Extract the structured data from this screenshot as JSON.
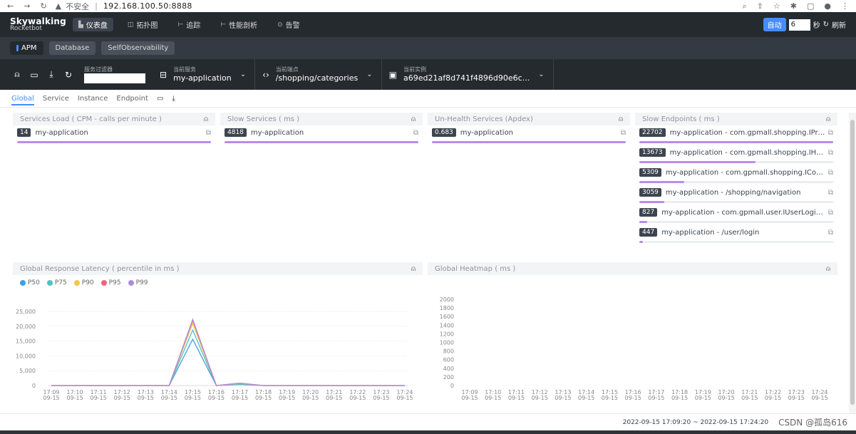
{
  "browser": {
    "security": "不安全",
    "url": "192.168.100.50:8888"
  },
  "topnav": {
    "logo_line1": "Skywalking",
    "logo_line2": "Rocketbot",
    "items": [
      {
        "icon": "dashboard-icon",
        "label": "仪表盘",
        "active": true
      },
      {
        "icon": "topology-icon",
        "label": "拓扑图",
        "active": false
      },
      {
        "icon": "trace-icon",
        "label": "追踪",
        "active": false
      },
      {
        "icon": "profile-icon",
        "label": "性能剖析",
        "active": false
      },
      {
        "icon": "alarm-icon",
        "label": "告警",
        "active": false
      }
    ],
    "auto_label": "自动",
    "interval_value": "6",
    "seconds_label": "秒",
    "refresh_label": "刷新"
  },
  "layers": [
    {
      "label": "APM",
      "active": true
    },
    {
      "label": "Database",
      "active": false
    },
    {
      "label": "SelfObservability",
      "active": false
    }
  ],
  "toolbar": {
    "filter_label": "服务过滤器",
    "service_label": "当前服务",
    "service_value": "my-application",
    "endpoint_label": "当前端点",
    "endpoint_value": "/shopping/categories",
    "instance_label": "当前实例",
    "instance_value": "a69ed21af8d741f4896d90e6c..."
  },
  "tabs": [
    "Global",
    "Service",
    "Instance",
    "Endpoint"
  ],
  "panels": {
    "services_load": {
      "title": "Services Load ( CPM - calls per minute )",
      "rows": [
        {
          "value": "14",
          "name": "my-application",
          "ratio": 1.0
        }
      ]
    },
    "slow_services": {
      "title": "Slow Services ( ms )",
      "rows": [
        {
          "value": "4818",
          "name": "my-application",
          "ratio": 1.0
        }
      ]
    },
    "unhealth_services": {
      "title": "Un-Health Services (Apdex)",
      "rows": [
        {
          "value": "0.683",
          "name": "my-application",
          "ratio": 1.0
        }
      ]
    },
    "slow_endpoints": {
      "title": "Slow Endpoints ( ms )",
      "rows": [
        {
          "value": "22702",
          "name": "my-application - com.gpmall.shopping.IProduct...",
          "ratio": 1.0
        },
        {
          "value": "13673",
          "name": "my-application - com.gpmall.shopping.IHomeSe...",
          "ratio": 0.6
        },
        {
          "value": "5309",
          "name": "my-application - com.gpmall.shopping.IContentS...",
          "ratio": 0.23
        },
        {
          "value": "3059",
          "name": "my-application - /shopping/navigation",
          "ratio": 0.13
        },
        {
          "value": "827",
          "name": "my-application - com.gpmall.user.IUserLoginServic...",
          "ratio": 0.04
        },
        {
          "value": "447",
          "name": "my-application - /user/login",
          "ratio": 0.02
        }
      ]
    },
    "latency": {
      "title": "Global Response Latency ( percentile in ms )"
    },
    "heatmap": {
      "title": "Global Heatmap ( ms )"
    }
  },
  "chart_data": [
    {
      "type": "line",
      "categories": [
        "17:09\n09-15",
        "17:10\n09-15",
        "17:11\n09-15",
        "17:12\n09-15",
        "17:13\n09-15",
        "17:14\n09-15",
        "17:15\n09-15",
        "17:16\n09-15",
        "17:17\n09-15",
        "17:18\n09-15",
        "17:19\n09-15",
        "17:20\n09-15",
        "17:21\n09-15",
        "17:22\n09-15",
        "17:23\n09-15",
        "17:24\n09-15"
      ],
      "y_ticks": [
        "0",
        "5,000",
        "10,000",
        "15,000",
        "20,000",
        "25,000"
      ],
      "ylim": [
        0,
        25000
      ],
      "grid": true,
      "legend": "top-left",
      "series": [
        {
          "name": "P50",
          "color": "#3f9fe6",
          "values": [
            0,
            0,
            0,
            0,
            0,
            0,
            15600,
            0,
            400,
            0,
            0,
            0,
            0,
            0,
            0,
            0
          ]
        },
        {
          "name": "P75",
          "color": "#4cc3c1",
          "values": [
            0,
            0,
            0,
            0,
            0,
            0,
            18700,
            0,
            500,
            0,
            0,
            0,
            0,
            0,
            0,
            0
          ]
        },
        {
          "name": "P90",
          "color": "#f5c54a",
          "values": [
            0,
            0,
            0,
            0,
            0,
            0,
            21000,
            0,
            700,
            0,
            0,
            0,
            0,
            0,
            0,
            0
          ]
        },
        {
          "name": "P95",
          "color": "#f2637b",
          "values": [
            0,
            0,
            0,
            0,
            0,
            0,
            22000,
            0,
            800,
            0,
            0,
            0,
            0,
            0,
            0,
            0
          ]
        },
        {
          "name": "P99",
          "color": "#a98ddf",
          "values": [
            0,
            0,
            0,
            0,
            0,
            0,
            22300,
            0,
            800,
            0,
            0,
            0,
            0,
            0,
            0,
            0
          ]
        }
      ]
    },
    {
      "type": "heatmap",
      "categories": [
        "17:09\n09-15",
        "17:10\n09-15",
        "17:11\n09-15",
        "17:12\n09-15",
        "17:13\n09-15",
        "17:14\n09-15",
        "17:15\n09-15",
        "17:16\n09-15",
        "17:17\n09-15",
        "17:18\n09-15",
        "17:19\n09-15",
        "17:20\n09-15",
        "17:21\n09-15",
        "17:22\n09-15",
        "17:23\n09-15",
        "17:24\n09-15"
      ],
      "y_ticks": [
        "0",
        "200",
        "400",
        "600",
        "800",
        "1000",
        "1200",
        "1400",
        "1600",
        "1800",
        "2000"
      ],
      "ylim": [
        0,
        2000
      ],
      "values": []
    }
  ],
  "footer": {
    "time_range": "2022-09-15 17:09:20 ~ 2022-09-15 17:24:20",
    "watermark": "CSDN @孤岛616"
  }
}
